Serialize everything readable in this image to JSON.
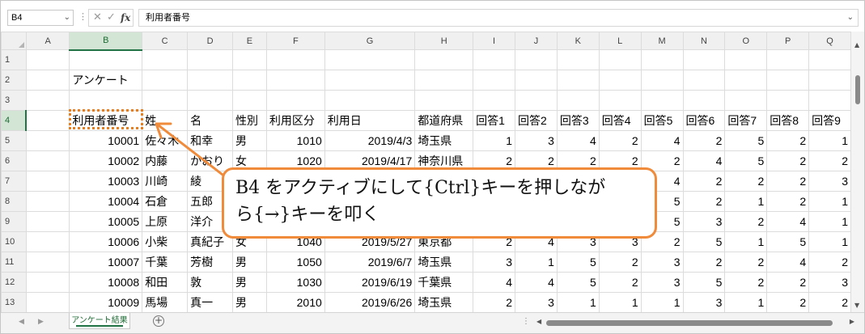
{
  "formula_bar": {
    "name_box": "B4",
    "separator": "⋮",
    "cancel_glyph": "✕",
    "enter_glyph": "✓",
    "fx_label": "fx",
    "content": "利用者番号",
    "expand_glyph": "⌄"
  },
  "columns": [
    "A",
    "B",
    "C",
    "D",
    "E",
    "F",
    "G",
    "H",
    "I",
    "J",
    "K",
    "L",
    "M",
    "N",
    "O",
    "P",
    "Q"
  ],
  "selected_column": "B",
  "rows": [
    {
      "num": "1",
      "cells": [
        "",
        "",
        "",
        "",
        "",
        "",
        "",
        "",
        "",
        "",
        "",
        "",
        "",
        "",
        "",
        "",
        ""
      ]
    },
    {
      "num": "2",
      "cells": [
        "",
        "アンケート",
        "",
        "",
        "",
        "",
        "",
        "",
        "",
        "",
        "",
        "",
        "",
        "",
        "",
        "",
        ""
      ]
    },
    {
      "num": "3",
      "cells": [
        "",
        "",
        "",
        "",
        "",
        "",
        "",
        "",
        "",
        "",
        "",
        "",
        "",
        "",
        "",
        "",
        ""
      ]
    },
    {
      "num": "4",
      "cells": [
        "",
        "利用者番号",
        "姓",
        "名",
        "性別",
        "利用区分",
        "利用日",
        "都道府県",
        "回答1",
        "回答2",
        "回答3",
        "回答4",
        "回答5",
        "回答6",
        "回答7",
        "回答8",
        "回答9"
      ]
    },
    {
      "num": "5",
      "cells": [
        "",
        "10001",
        "佐々木",
        "和幸",
        "男",
        "1010",
        "2019/4/3",
        "埼玉県",
        "1",
        "3",
        "4",
        "2",
        "4",
        "2",
        "5",
        "2",
        "1"
      ]
    },
    {
      "num": "6",
      "cells": [
        "",
        "10002",
        "内藤",
        "かおり",
        "女",
        "1020",
        "2019/4/17",
        "神奈川県",
        "2",
        "2",
        "2",
        "2",
        "2",
        "4",
        "5",
        "2",
        "2"
      ]
    },
    {
      "num": "7",
      "cells": [
        "",
        "10003",
        "川崎",
        "綾",
        "",
        "",
        "",
        "",
        "",
        "",
        "",
        "",
        "4",
        "2",
        "2",
        "2",
        "3"
      ]
    },
    {
      "num": "8",
      "cells": [
        "",
        "10004",
        "石倉",
        "五郎",
        "",
        "",
        "",
        "",
        "",
        "",
        "",
        "",
        "5",
        "2",
        "1",
        "2",
        "1"
      ]
    },
    {
      "num": "9",
      "cells": [
        "",
        "10005",
        "上原",
        "洋介",
        "",
        "",
        "",
        "",
        "",
        "",
        "",
        "",
        "5",
        "3",
        "2",
        "4",
        "1"
      ]
    },
    {
      "num": "10",
      "cells": [
        "",
        "10006",
        "小柴",
        "真紀子",
        "女",
        "1040",
        "2019/5/27",
        "東京都",
        "2",
        "4",
        "3",
        "3",
        "2",
        "5",
        "1",
        "5",
        "1"
      ]
    },
    {
      "num": "11",
      "cells": [
        "",
        "10007",
        "千葉",
        "芳樹",
        "男",
        "1050",
        "2019/6/7",
        "埼玉県",
        "3",
        "1",
        "5",
        "2",
        "3",
        "2",
        "2",
        "4",
        "2"
      ]
    },
    {
      "num": "12",
      "cells": [
        "",
        "10008",
        "和田",
        "敦",
        "男",
        "1030",
        "2019/6/19",
        "千葉県",
        "4",
        "4",
        "5",
        "2",
        "3",
        "5",
        "2",
        "2",
        "3"
      ]
    },
    {
      "num": "13",
      "cells": [
        "",
        "10009",
        "馬場",
        "真一",
        "男",
        "2010",
        "2019/6/26",
        "埼玉県",
        "2",
        "3",
        "1",
        "1",
        "1",
        "3",
        "1",
        "2",
        "2"
      ]
    }
  ],
  "selected_row": "4",
  "sheet_tabs": {
    "prev_glyph": "◀",
    "next_glyph": "▶",
    "active": "アンケート結果",
    "add_glyph": "+",
    "dots": "⋮"
  },
  "scroll_glyphs": {
    "up": "▲",
    "down": "▼",
    "left": "◀",
    "right": "▶"
  },
  "callout": {
    "line1": "B4 をアクティブにして{Ctrl}キーを押しなが",
    "line2": "ら{→}キーを叩く",
    "border_color": "#ef8b3a"
  },
  "colors": {
    "selection_green": "#217346",
    "header_selected_bg": "#d3e6d5",
    "active_cell_border": "#e67e22"
  }
}
